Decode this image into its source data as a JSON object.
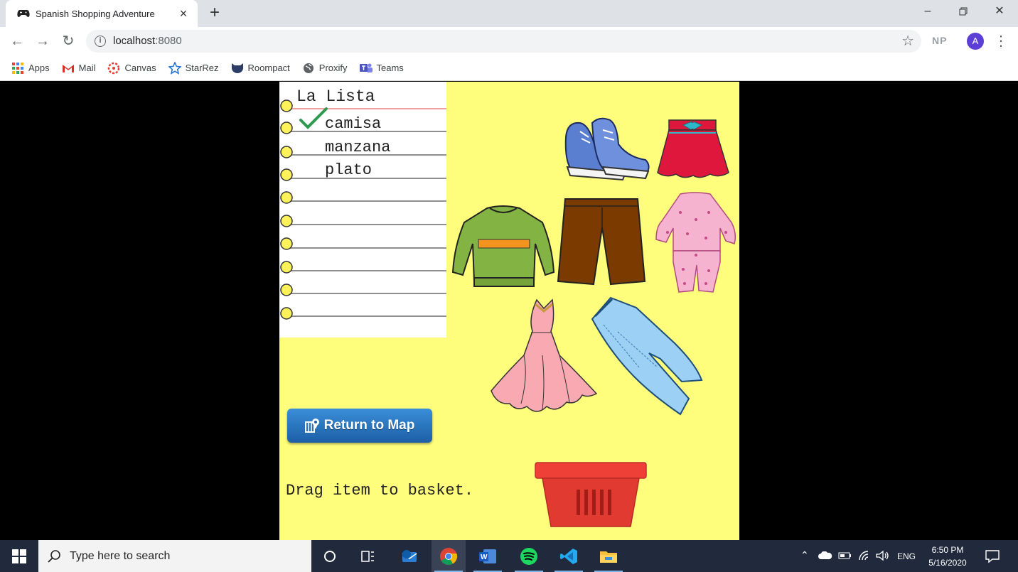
{
  "browser": {
    "tab_title": "Spanish Shopping Adventure",
    "tab_close": "×",
    "new_tab": "+",
    "url_host": "localhost",
    "url_port": ":8080",
    "profile_initials": "NP",
    "avatar_letter": "A"
  },
  "bookmarks": [
    {
      "label": "Apps",
      "icon": "apps-grid-icon"
    },
    {
      "label": "Mail",
      "icon": "gmail-icon"
    },
    {
      "label": "Canvas",
      "icon": "canvas-icon"
    },
    {
      "label": "StarRez",
      "icon": "starrez-icon"
    },
    {
      "label": "Roompact",
      "icon": "roompact-icon"
    },
    {
      "label": "Proxify",
      "icon": "globe-icon"
    },
    {
      "label": "Teams",
      "icon": "teams-icon"
    }
  ],
  "game": {
    "list_title": "La Lista",
    "list_items": [
      {
        "label": "camisa",
        "checked": true
      },
      {
        "label": "manzana",
        "checked": false
      },
      {
        "label": "plato",
        "checked": false
      }
    ],
    "return_button": "Return to Map",
    "drag_hint": "Drag item to basket.",
    "items": [
      "sneakers",
      "skirt",
      "sweater",
      "pants",
      "pajamas",
      "dress",
      "jeans",
      "basket"
    ],
    "colors": {
      "background": "#fffe7c",
      "button": "#2a76c2",
      "basket": "#d93a2f"
    }
  },
  "taskbar": {
    "search_placeholder": "Type here to search",
    "language": "ENG",
    "time": "6:50 PM",
    "date": "5/16/2020"
  }
}
